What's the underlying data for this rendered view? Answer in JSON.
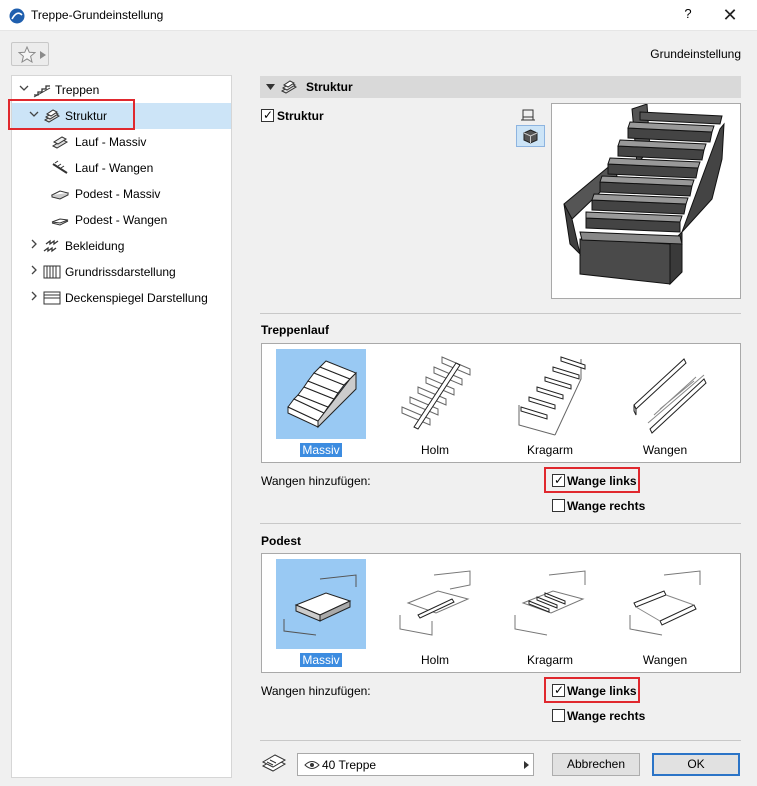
{
  "window": {
    "title": "Treppe-Grundeinstellung",
    "help": "?",
    "close": "✕"
  },
  "header": {
    "section_name": "Grundeinstellung"
  },
  "tree": {
    "items": [
      {
        "label": "Treppen",
        "icon": "stair-icon"
      },
      {
        "label": "Struktur",
        "icon": "structure-icon",
        "selected": true
      },
      {
        "label": "Lauf - Massiv",
        "icon": "run-solid-icon"
      },
      {
        "label": "Lauf - Wangen",
        "icon": "run-stringer-icon"
      },
      {
        "label": "Podest - Massiv",
        "icon": "landing-solid-icon"
      },
      {
        "label": "Podest - Wangen",
        "icon": "landing-stringer-icon"
      },
      {
        "label": "Bekleidung",
        "icon": "finish-icon"
      },
      {
        "label": "Grundrissdarstellung",
        "icon": "floorplan-icon"
      },
      {
        "label": "Deckenspiegel Darstellung",
        "icon": "ceiling-plan-icon"
      }
    ]
  },
  "panel": {
    "title": "Struktur",
    "structure_checkbox": {
      "label": "Struktur",
      "checked": true
    }
  },
  "treppenlauf": {
    "heading": "Treppenlauf",
    "options": [
      {
        "label": "Massiv",
        "selected": true
      },
      {
        "label": "Holm",
        "selected": false
      },
      {
        "label": "Kragarm",
        "selected": false
      },
      {
        "label": "Wangen",
        "selected": false
      }
    ],
    "add_stringers_label": "Wangen hinzufügen:",
    "left": {
      "label": "Wange links",
      "checked": true
    },
    "right": {
      "label": "Wange rechts",
      "checked": false
    }
  },
  "podest": {
    "heading": "Podest",
    "options": [
      {
        "label": "Massiv",
        "selected": true
      },
      {
        "label": "Holm",
        "selected": false
      },
      {
        "label": "Kragarm",
        "selected": false
      },
      {
        "label": "Wangen",
        "selected": false
      }
    ],
    "add_stringers_label": "Wangen hinzufügen:",
    "left": {
      "label": "Wange links",
      "checked": true
    },
    "right": {
      "label": "Wange rechts",
      "checked": false
    }
  },
  "footer": {
    "layer": "40 Treppe",
    "cancel": "Abbrechen",
    "ok": "OK"
  },
  "colors": {
    "selection": "#cce4f7",
    "thumb_selected": "#99c9f3",
    "caption_selected": "#3c8ce0",
    "highlight": "#e0282e"
  }
}
